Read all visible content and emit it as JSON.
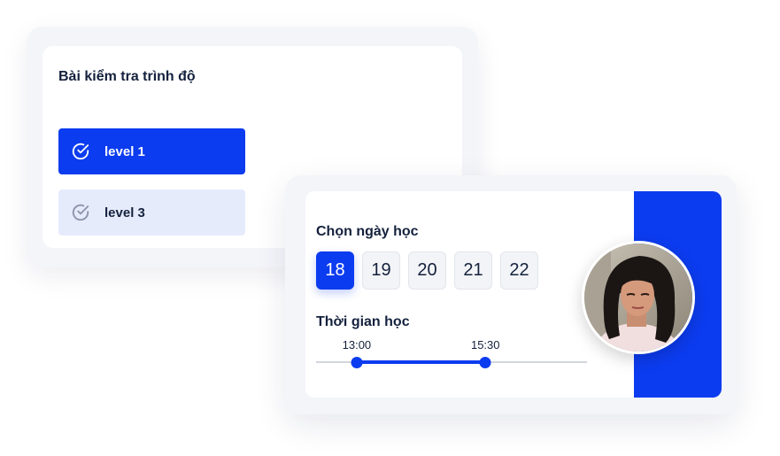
{
  "level_test": {
    "title": "Bài kiểm tra trình độ",
    "options": [
      {
        "label": "level 1",
        "selected": true,
        "icon": "check-circle-icon"
      },
      {
        "label": "level 3",
        "selected": false,
        "icon": "check-circle-icon"
      }
    ]
  },
  "schedule": {
    "date_title": "Chọn ngày học",
    "dates": [
      "18",
      "19",
      "20",
      "21",
      "22"
    ],
    "selected_date": "18",
    "time_title": "Thời gian học",
    "time_slider": {
      "start": "13:00",
      "end": "15:30",
      "start_fraction": 0.15,
      "end_fraction": 0.625
    }
  },
  "colors": {
    "accent": "#0c3cf0",
    "accent_light": "#e6ebfc",
    "text_dark": "#14213d"
  }
}
